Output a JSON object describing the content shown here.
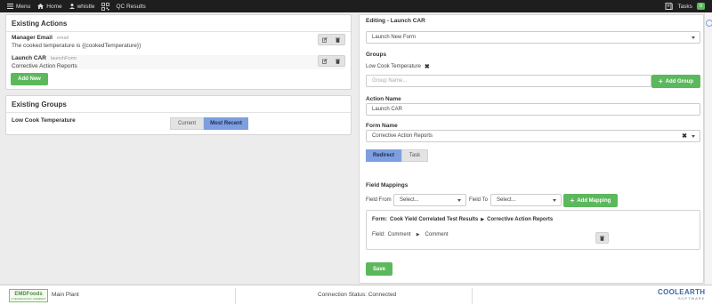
{
  "nav": {
    "menu": "Menu",
    "home": "Home",
    "user": "whistle",
    "qc_results": "QC Results",
    "tasks": "Tasks",
    "tasks_count": "0"
  },
  "existing_actions": {
    "title": "Existing Actions",
    "items": [
      {
        "name": "Manager Email",
        "type": "email",
        "desc": "The cooked temperature is {{cookedTemperature}}"
      },
      {
        "name": "Launch CAR",
        "type": "launchForm",
        "desc": "Corrective Action Reports"
      }
    ],
    "add_new": "Add New"
  },
  "existing_groups": {
    "title": "Existing Groups",
    "group_name": "Low Cook Temperature",
    "toggle_current": "Current",
    "toggle_recent": "Most Recent"
  },
  "editor": {
    "title": "Editing - Launch CAR",
    "action_type": "Launch New Form",
    "groups_label": "Groups",
    "group_tag": "Low Cook Temperature",
    "group_name_placeholder": "Group Name...",
    "add_group": "Add Group",
    "action_name_label": "Action Name",
    "action_name_value": "Launch CAR",
    "form_name_label": "Form Name",
    "form_name_value": "Corrective Action Reports",
    "mode_redirect": "Redirect",
    "mode_task": "Task",
    "field_mappings_label": "Field Mappings",
    "field_from_label": "Field From",
    "field_from_value": "Select...",
    "field_to_label": "Field To",
    "field_to_value": "Select...",
    "add_mapping": "Add Mapping",
    "mapping_form_label": "Form:",
    "mapping_source": "Cook Yield Correlated Test Results",
    "mapping_target": "Corrective Action Reports",
    "mapping_field_label": "Field:",
    "mapping_field_from": "Comment",
    "mapping_field_to": "Comment",
    "save": "Save"
  },
  "footer": {
    "logo_text": "EMDFoods",
    "logo_sub": "A TECHNOLOGY COMPANY",
    "plant": "Main Plant",
    "connection_status": "Connection Status: Connected",
    "brand_main": "COOLEARTH",
    "brand_sub": "SOFTWARE"
  },
  "colors": {
    "accent_green": "#5cb85c",
    "toggle_active": "#7d9fe0",
    "nav_bg": "#1e1e1e"
  }
}
